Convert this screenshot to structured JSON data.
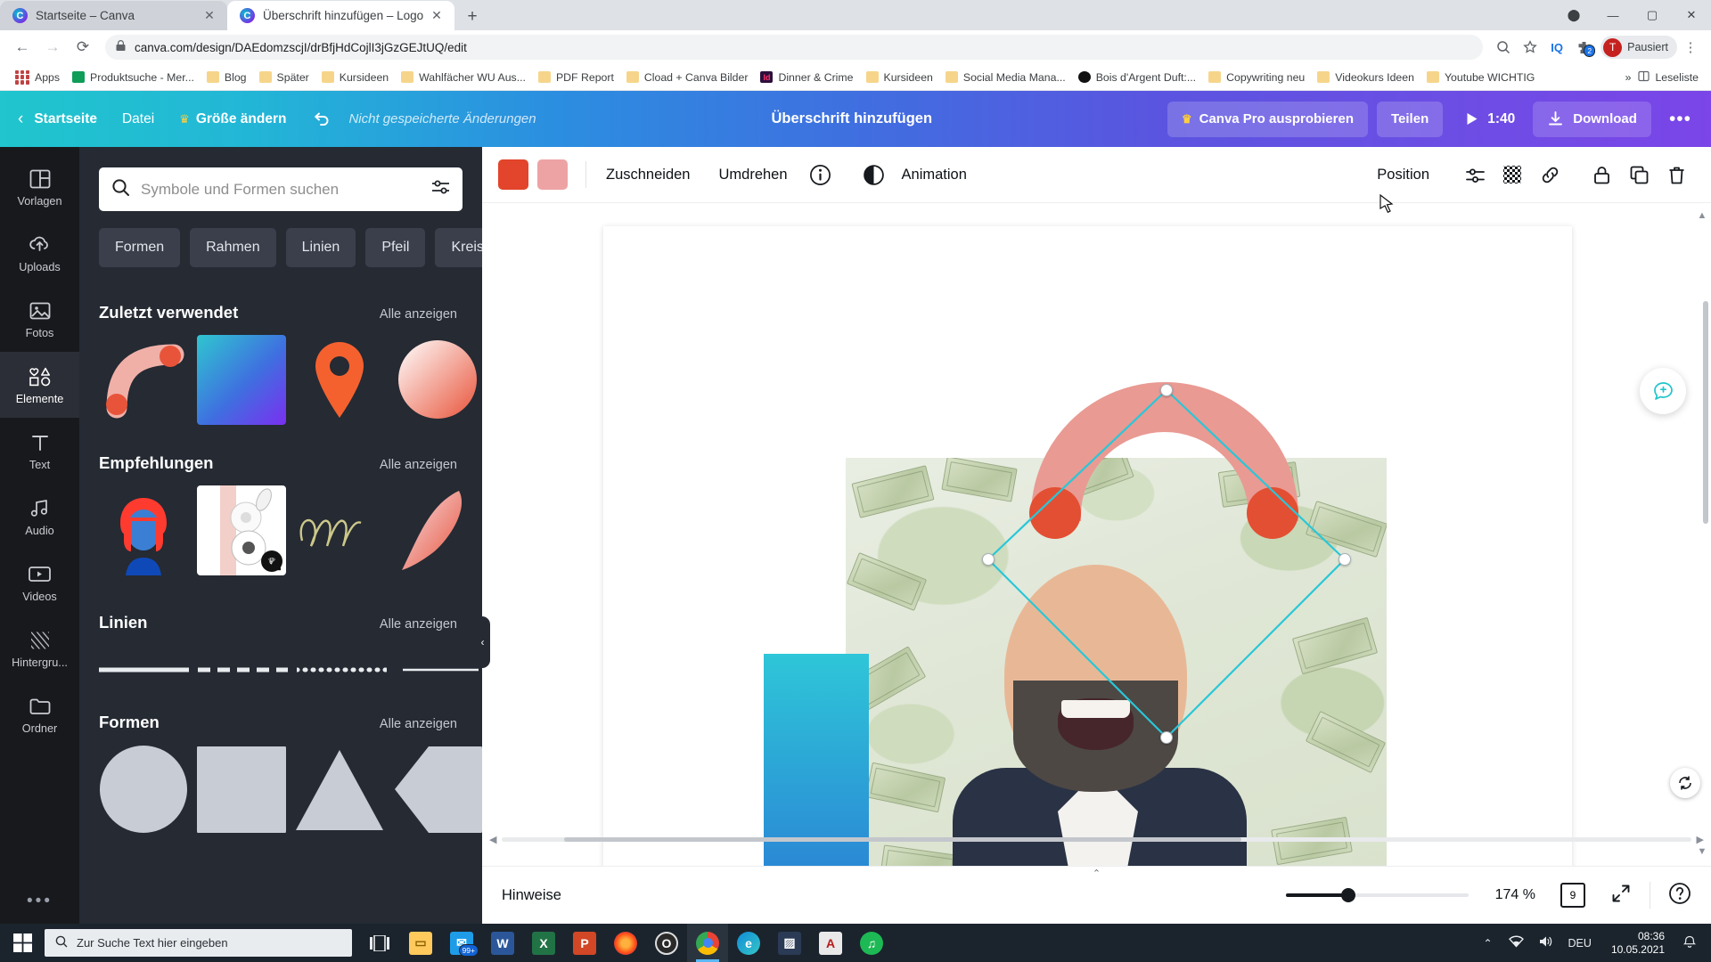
{
  "browser": {
    "tabs": [
      {
        "title": "Startseite – Canva",
        "active": false
      },
      {
        "title": "Überschrift hinzufügen – Logo",
        "active": true
      }
    ],
    "new_tab_label": "+",
    "window_controls": {
      "minimize": "—",
      "maximize": "▢",
      "close": "✕",
      "extension": "⬤"
    },
    "nav": {
      "back": "←",
      "forward": "→",
      "reload": "⟳"
    },
    "address": {
      "lock": "🔒",
      "url": "canva.com/design/DAEdomzscjI/drBfjHdCojlI3jGzGEJtUQ/edit"
    },
    "toolbar_icons": [
      "zoom-icon",
      "star-icon",
      "iq-icon",
      "puzzle-icon",
      "menu-icon"
    ],
    "iq_label": "IQ",
    "ext_badge": "2",
    "profile": {
      "initial": "T",
      "label": "Pausiert"
    },
    "bookmarks": [
      {
        "label": "Apps",
        "icon": "apps-grid"
      },
      {
        "label": "Produktsuche - Mer...",
        "icon": "green"
      },
      {
        "label": "Blog",
        "icon": "folder"
      },
      {
        "label": "Später",
        "icon": "folder"
      },
      {
        "label": "Kursideen",
        "icon": "folder"
      },
      {
        "label": "Wahlfächer WU Aus...",
        "icon": "folder"
      },
      {
        "label": "PDF Report",
        "icon": "folder"
      },
      {
        "label": "Cload + Canva Bilder",
        "icon": "folder"
      },
      {
        "label": "Dinner & Crime",
        "icon": "indesign"
      },
      {
        "label": "Kursideen",
        "icon": "folder"
      },
      {
        "label": "Social Media Mana...",
        "icon": "folder"
      },
      {
        "label": "Bois d'Argent Duft:...",
        "icon": "black"
      },
      {
        "label": "Copywriting neu",
        "icon": "folder"
      },
      {
        "label": "Videokurs Ideen",
        "icon": "folder"
      },
      {
        "label": "Youtube WICHTIG",
        "icon": "folder"
      }
    ],
    "bookmarks_overflow": "»",
    "reading_list": "Leseliste"
  },
  "canva": {
    "header": {
      "back_icon": "chevron-left-icon",
      "home": "Startseite",
      "file": "Datei",
      "resize": "Größe ändern",
      "resize_crown": "♛",
      "undo_icon": "undo-icon",
      "unsaved": "Nicht gespeicherte Änderungen",
      "doc_title": "Überschrift hinzufügen",
      "pro_label": "Canva Pro ausprobieren",
      "pro_crown": "♛",
      "share": "Teilen",
      "timer": "1:40",
      "play_icon": "play-icon",
      "download": "Download",
      "download_icon": "download-icon",
      "more": "•••"
    },
    "sidebar": [
      {
        "label": "Vorlagen",
        "icon": "templates-icon",
        "active": false
      },
      {
        "label": "Uploads",
        "icon": "upload-cloud-icon",
        "active": false
      },
      {
        "label": "Fotos",
        "icon": "photo-icon",
        "active": false
      },
      {
        "label": "Elemente",
        "icon": "shapes-icon",
        "active": true
      },
      {
        "label": "Text",
        "icon": "text-icon",
        "active": false
      },
      {
        "label": "Audio",
        "icon": "audio-icon",
        "active": false
      },
      {
        "label": "Videos",
        "icon": "video-icon",
        "active": false
      },
      {
        "label": "Hintergru...",
        "icon": "background-icon",
        "active": false
      },
      {
        "label": "Ordner",
        "icon": "folder-icon",
        "active": false
      }
    ],
    "sidebar_more": "•••",
    "panel": {
      "search_placeholder": "Symbole und Formen suchen",
      "search_icon": "search-icon",
      "filter_icon": "sliders-icon",
      "chips": [
        "Formen",
        "Rahmen",
        "Linien",
        "Pfeil",
        "Kreis"
      ],
      "chips_next": "›",
      "sections": [
        {
          "title": "Zuletzt verwendet",
          "all": "Alle anzeigen"
        },
        {
          "title": "Empfehlungen",
          "all": "Alle anzeigen"
        },
        {
          "title": "Linien",
          "all": "Alle anzeigen"
        },
        {
          "title": "Formen",
          "all": "Alle anzeigen"
        }
      ],
      "collapse_icon": "‹"
    },
    "editor_toolbar": {
      "color1": "#e2452b",
      "color2": "#eda3a4",
      "crop": "Zuschneiden",
      "flip": "Umdrehen",
      "info_icon": "info-icon",
      "animation": "Animation",
      "animation_icon": "animation-icon",
      "position": "Position",
      "right_icons": [
        "effects-icon",
        "transparency-icon",
        "link-icon",
        "lock-icon",
        "duplicate-icon",
        "delete-icon"
      ]
    },
    "status": {
      "notes": "Hinweise",
      "zoom_value": "174 %",
      "page_count": "9",
      "expand_icon": "expand-icon",
      "help_icon": "help-icon",
      "collapse_icon": "⌃"
    }
  },
  "taskbar": {
    "start_icon": "windows-icon",
    "search_placeholder": "Zur Suche Text hier eingeben",
    "search_icon": "search-icon",
    "taskview_icon": "task-view-icon",
    "apps": [
      {
        "name": "file-explorer",
        "glyph": "📁",
        "color": "#ffc95c",
        "badge": null
      },
      {
        "name": "mail",
        "glyph": "✉",
        "color": "#1e9ce8",
        "badge": "99+"
      },
      {
        "name": "word",
        "glyph": "W",
        "color": "#2b579a",
        "badge": null
      },
      {
        "name": "excel",
        "glyph": "X",
        "color": "#217346",
        "badge": null
      },
      {
        "name": "powerpoint",
        "glyph": "P",
        "color": "#d24726",
        "badge": null
      },
      {
        "name": "firefox",
        "glyph": "◉",
        "color": "#ff7139",
        "badge": null
      },
      {
        "name": "opera",
        "glyph": "O",
        "color": "#333333",
        "badge": null
      },
      {
        "name": "chrome",
        "glyph": "◎",
        "color": "#e8e8e8",
        "badge": null,
        "active": true
      },
      {
        "name": "edge",
        "glyph": "e",
        "color": "#0f8bd8",
        "badge": null
      },
      {
        "name": "photos",
        "glyph": "▨",
        "color": "#2b3a55",
        "badge": null
      },
      {
        "name": "acrobat",
        "glyph": "A",
        "color": "#b81b1b",
        "badge": null
      },
      {
        "name": "spotify",
        "glyph": "♫",
        "color": "#1db954",
        "badge": null
      }
    ],
    "tray": {
      "chevron": "⌃",
      "network_icon": "wifi-icon",
      "volume_icon": "volume-icon",
      "language": "DEU",
      "time": "08:36",
      "date": "10.05.2021",
      "notification_icon": "notification-icon"
    }
  }
}
